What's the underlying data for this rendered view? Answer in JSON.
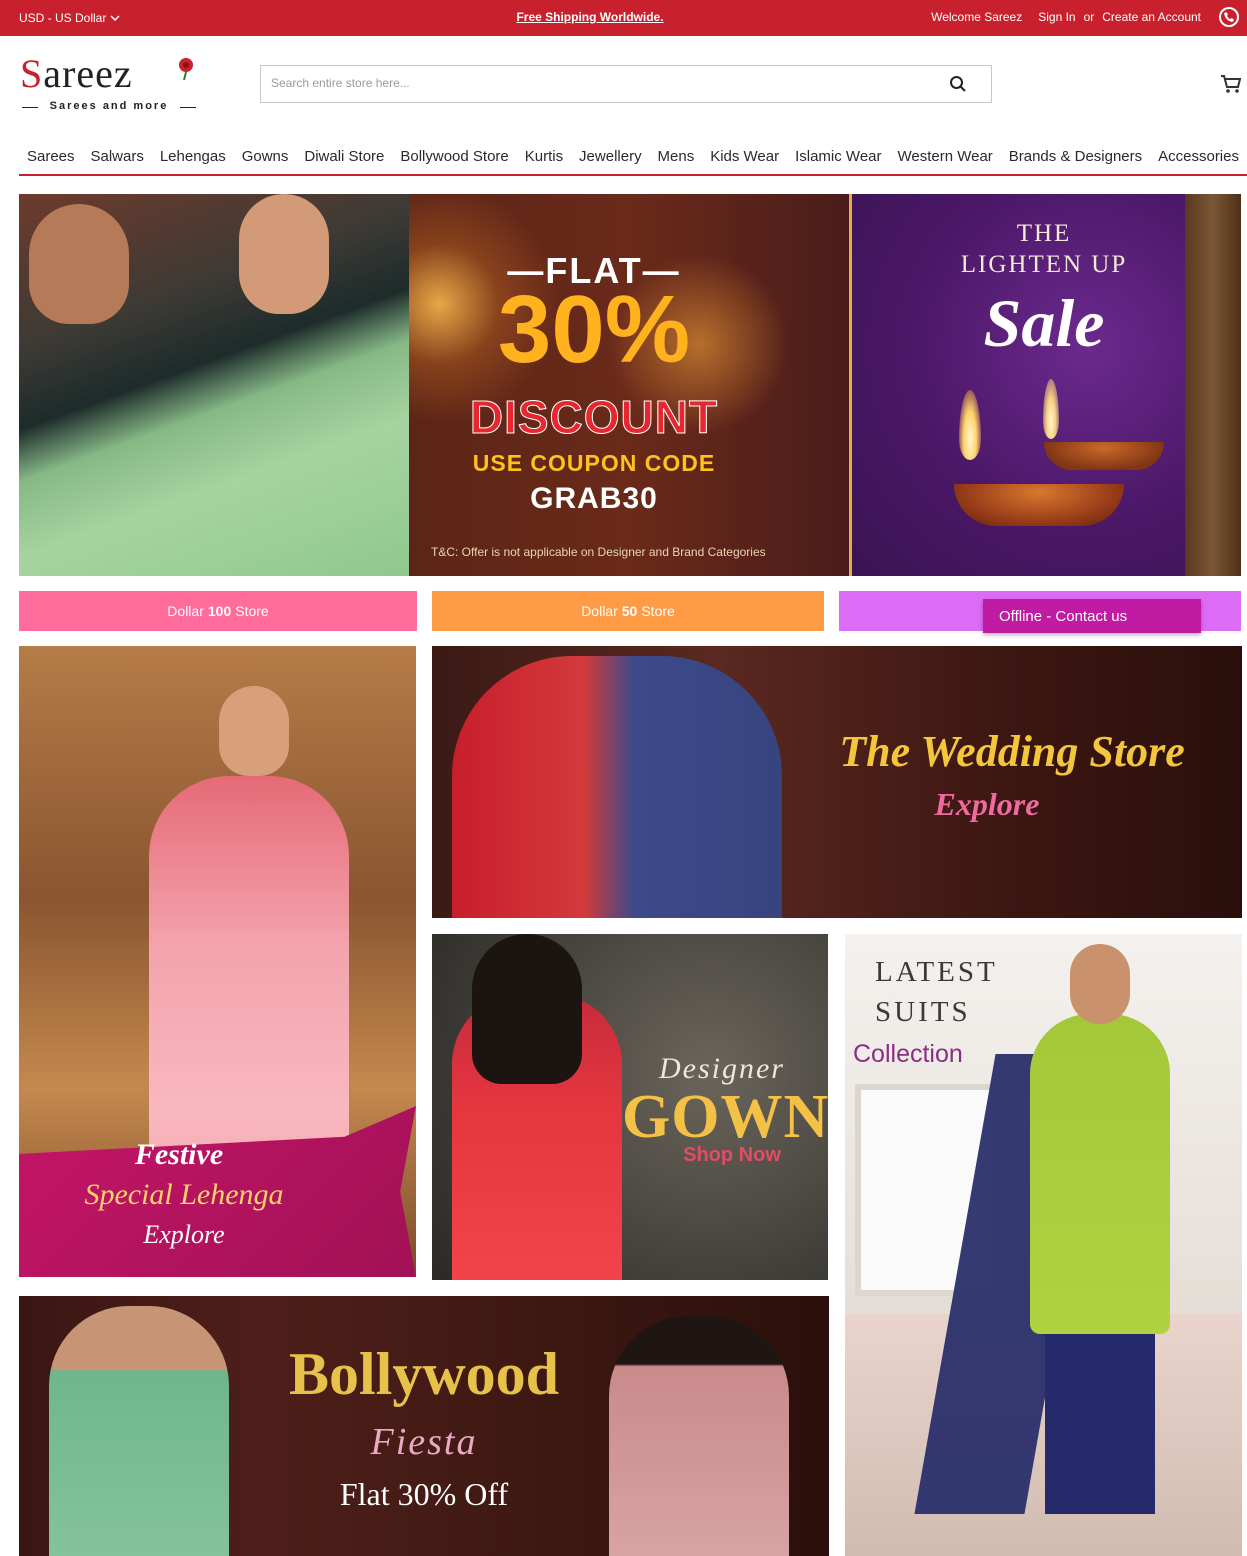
{
  "topbar": {
    "currency": "USD - US Dollar",
    "shipping": "Free Shipping Worldwide.",
    "welcome": "Welcome Sareez",
    "sign_in": "Sign In",
    "or": "or",
    "create_account": "Create an Account"
  },
  "logo": {
    "first_letter": "S",
    "rest": "areez",
    "tagline": "Sarees and more"
  },
  "search": {
    "placeholder": "Search entire store here..."
  },
  "nav": {
    "items": [
      "Sarees",
      "Salwars",
      "Lehengas",
      "Gowns",
      "Diwali Store",
      "Bollywood Store",
      "Kurtis",
      "Jewellery",
      "Mens",
      "Kids Wear",
      "Islamic Wear",
      "Western Wear",
      "Brands & Designers",
      "Accessories"
    ]
  },
  "hero": {
    "flat": "—FLAT—",
    "percent": "30%",
    "discount": "DISCOUNT",
    "use_coupon": "USE COUPON CODE",
    "code": "GRAB30",
    "tnc": "T&C: Offer is not applicable on Designer and Brand Categories",
    "headline_line1": "THE",
    "headline_line2": "LIGHTEN UP",
    "sale": "Sale"
  },
  "stores": [
    {
      "prefix": "Dollar",
      "amount": "100",
      "suffix": "Store"
    },
    {
      "prefix": "Dollar",
      "amount": "50",
      "suffix": "Store"
    }
  ],
  "chat": {
    "label": "Offline - Contact us"
  },
  "tiles": {
    "lehenga": {
      "line1": "Festive",
      "line2": "Special Lehenga",
      "line3": "Explore"
    },
    "wedding": {
      "line1": "The Wedding Store",
      "line2": "Explore"
    },
    "gowns": {
      "line1": "Designer",
      "line2": "GOWNS",
      "line3": "Shop Now"
    },
    "suits": {
      "line1": "LATEST",
      "line2": "SUITS",
      "line3": "Collection"
    },
    "bollywood": {
      "line1": "Bollywood",
      "line2": "Fiesta",
      "line3": "Flat 30% Off"
    }
  },
  "colors": {
    "brand_red": "#c8202c",
    "pink": "#ff6b9a",
    "orange": "#ff9b45",
    "violet": "#dc6bf5",
    "chat": "#c21ba3"
  }
}
